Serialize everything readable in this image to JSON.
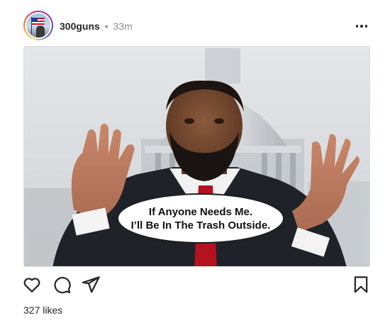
{
  "post": {
    "author": {
      "username": "300guns",
      "separator": "•",
      "time_ago": "33m",
      "avatar": "avatar-photo-with-flag"
    },
    "menu_icon": "more-horizontal-icon",
    "image": {
      "caption_lines": [
        "If Anyone Needs Me.",
        "I’ll Be In The Trash Outside."
      ]
    },
    "actions": {
      "like_icon": "heart-icon",
      "comment_icon": "comment-icon",
      "share_icon": "send-icon",
      "save_icon": "bookmark-icon"
    },
    "likes_text": "327 likes"
  },
  "colors": {
    "text": "#262626",
    "muted": "#8e8e8e",
    "border": "#dbdbdb",
    "background": "#ffffff"
  }
}
